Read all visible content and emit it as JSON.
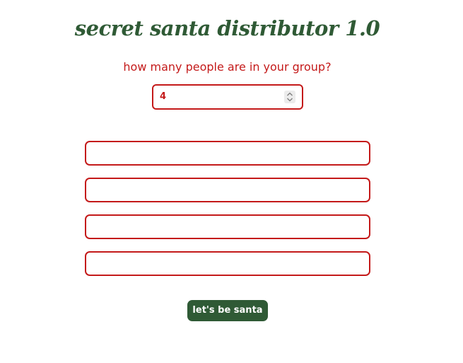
{
  "app": {
    "title": "secret santa distributor 1.0"
  },
  "group_size": {
    "question": "how many people are in your group?",
    "value": "4",
    "spinner_icon": "spinner-up-down-icon"
  },
  "names": [
    {
      "value": ""
    },
    {
      "value": ""
    },
    {
      "value": ""
    },
    {
      "value": ""
    }
  ],
  "submit": {
    "label": "let's be santa"
  },
  "colors": {
    "accent_red": "#c41a1a",
    "brand_green": "#2f5a35",
    "background": "#ffffff"
  }
}
